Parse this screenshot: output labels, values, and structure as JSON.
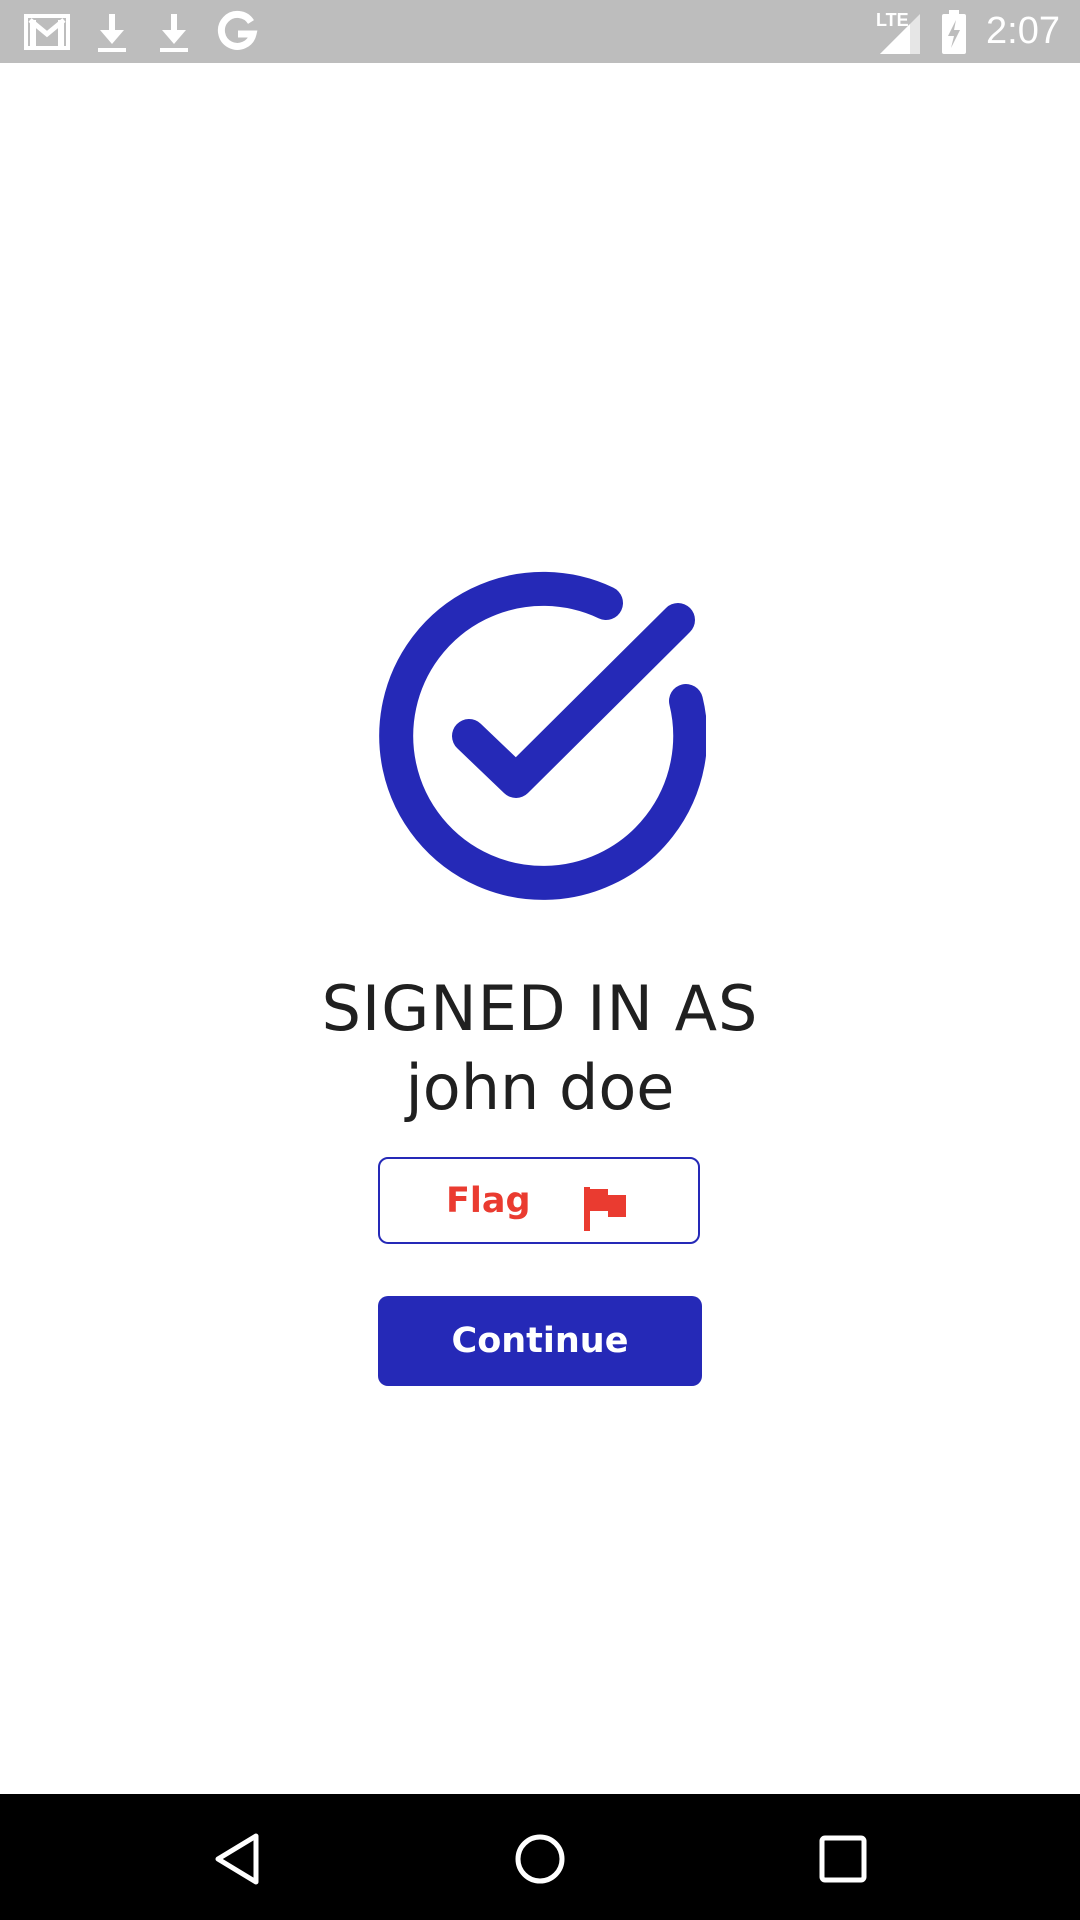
{
  "status_bar": {
    "time": "2:07",
    "network": "LTE",
    "icons": [
      "gmail-icon",
      "download-icon",
      "download-icon",
      "google-icon",
      "signal-icon",
      "battery-charging-icon"
    ]
  },
  "main": {
    "success_icon": "check-circle-icon",
    "title": "SIGNED IN AS",
    "username": "john doe",
    "flag_button": {
      "label": "Flag",
      "icon": "flag-icon"
    },
    "continue_button": {
      "label": "Continue"
    }
  },
  "nav_bar": {
    "icons": [
      "back-icon",
      "home-icon",
      "recents-icon"
    ]
  },
  "colors": {
    "accent": "#2529b7",
    "flag": "#ea3b30",
    "status_bar": "#bdbdbd",
    "nav_bar": "#000000",
    "text": "#202020"
  }
}
